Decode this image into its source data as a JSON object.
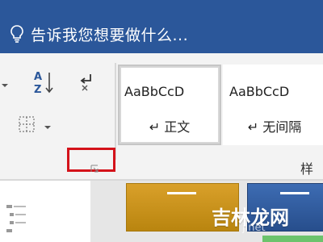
{
  "tellme": {
    "placeholder": "告诉我您想要做什么...",
    "icon": "lightbulb-icon"
  },
  "ribbon": {
    "sort_icon": "sort-az-icon",
    "paragraph_mark_icon": "paragraph-mark-icon",
    "borders_icon": "borders-icon",
    "styles": [
      {
        "preview": "AaBbCcD",
        "label": "正文",
        "selected": true
      },
      {
        "preview": "AaBbCcD",
        "label": "无间隔",
        "selected": false
      }
    ],
    "styles_group_label": "样",
    "dialog_launcher_icon": "dialog-launcher-icon"
  },
  "colors": {
    "title_bar": "#2b579a",
    "highlight_red": "#d4121a",
    "gold_block": "#d9a02a",
    "blue_block": "#3d6cb3"
  },
  "watermark": {
    "text": "吉林龙网",
    "subtext": "jlnet"
  }
}
